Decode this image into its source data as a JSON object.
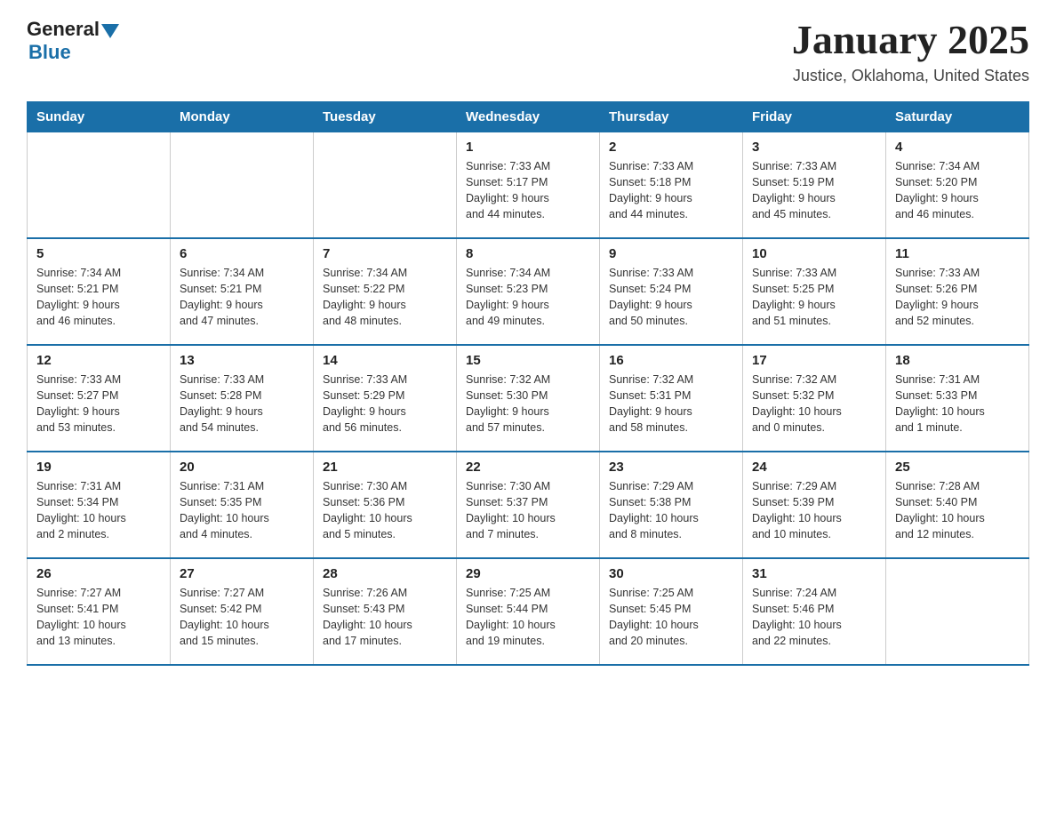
{
  "header": {
    "logo_general": "General",
    "logo_blue": "Blue",
    "title": "January 2025",
    "subtitle": "Justice, Oklahoma, United States"
  },
  "calendar": {
    "days_of_week": [
      "Sunday",
      "Monday",
      "Tuesday",
      "Wednesday",
      "Thursday",
      "Friday",
      "Saturday"
    ],
    "weeks": [
      [
        {
          "day": "",
          "info": ""
        },
        {
          "day": "",
          "info": ""
        },
        {
          "day": "",
          "info": ""
        },
        {
          "day": "1",
          "info": "Sunrise: 7:33 AM\nSunset: 5:17 PM\nDaylight: 9 hours\nand 44 minutes."
        },
        {
          "day": "2",
          "info": "Sunrise: 7:33 AM\nSunset: 5:18 PM\nDaylight: 9 hours\nand 44 minutes."
        },
        {
          "day": "3",
          "info": "Sunrise: 7:33 AM\nSunset: 5:19 PM\nDaylight: 9 hours\nand 45 minutes."
        },
        {
          "day": "4",
          "info": "Sunrise: 7:34 AM\nSunset: 5:20 PM\nDaylight: 9 hours\nand 46 minutes."
        }
      ],
      [
        {
          "day": "5",
          "info": "Sunrise: 7:34 AM\nSunset: 5:21 PM\nDaylight: 9 hours\nand 46 minutes."
        },
        {
          "day": "6",
          "info": "Sunrise: 7:34 AM\nSunset: 5:21 PM\nDaylight: 9 hours\nand 47 minutes."
        },
        {
          "day": "7",
          "info": "Sunrise: 7:34 AM\nSunset: 5:22 PM\nDaylight: 9 hours\nand 48 minutes."
        },
        {
          "day": "8",
          "info": "Sunrise: 7:34 AM\nSunset: 5:23 PM\nDaylight: 9 hours\nand 49 minutes."
        },
        {
          "day": "9",
          "info": "Sunrise: 7:33 AM\nSunset: 5:24 PM\nDaylight: 9 hours\nand 50 minutes."
        },
        {
          "day": "10",
          "info": "Sunrise: 7:33 AM\nSunset: 5:25 PM\nDaylight: 9 hours\nand 51 minutes."
        },
        {
          "day": "11",
          "info": "Sunrise: 7:33 AM\nSunset: 5:26 PM\nDaylight: 9 hours\nand 52 minutes."
        }
      ],
      [
        {
          "day": "12",
          "info": "Sunrise: 7:33 AM\nSunset: 5:27 PM\nDaylight: 9 hours\nand 53 minutes."
        },
        {
          "day": "13",
          "info": "Sunrise: 7:33 AM\nSunset: 5:28 PM\nDaylight: 9 hours\nand 54 minutes."
        },
        {
          "day": "14",
          "info": "Sunrise: 7:33 AM\nSunset: 5:29 PM\nDaylight: 9 hours\nand 56 minutes."
        },
        {
          "day": "15",
          "info": "Sunrise: 7:32 AM\nSunset: 5:30 PM\nDaylight: 9 hours\nand 57 minutes."
        },
        {
          "day": "16",
          "info": "Sunrise: 7:32 AM\nSunset: 5:31 PM\nDaylight: 9 hours\nand 58 minutes."
        },
        {
          "day": "17",
          "info": "Sunrise: 7:32 AM\nSunset: 5:32 PM\nDaylight: 10 hours\nand 0 minutes."
        },
        {
          "day": "18",
          "info": "Sunrise: 7:31 AM\nSunset: 5:33 PM\nDaylight: 10 hours\nand 1 minute."
        }
      ],
      [
        {
          "day": "19",
          "info": "Sunrise: 7:31 AM\nSunset: 5:34 PM\nDaylight: 10 hours\nand 2 minutes."
        },
        {
          "day": "20",
          "info": "Sunrise: 7:31 AM\nSunset: 5:35 PM\nDaylight: 10 hours\nand 4 minutes."
        },
        {
          "day": "21",
          "info": "Sunrise: 7:30 AM\nSunset: 5:36 PM\nDaylight: 10 hours\nand 5 minutes."
        },
        {
          "day": "22",
          "info": "Sunrise: 7:30 AM\nSunset: 5:37 PM\nDaylight: 10 hours\nand 7 minutes."
        },
        {
          "day": "23",
          "info": "Sunrise: 7:29 AM\nSunset: 5:38 PM\nDaylight: 10 hours\nand 8 minutes."
        },
        {
          "day": "24",
          "info": "Sunrise: 7:29 AM\nSunset: 5:39 PM\nDaylight: 10 hours\nand 10 minutes."
        },
        {
          "day": "25",
          "info": "Sunrise: 7:28 AM\nSunset: 5:40 PM\nDaylight: 10 hours\nand 12 minutes."
        }
      ],
      [
        {
          "day": "26",
          "info": "Sunrise: 7:27 AM\nSunset: 5:41 PM\nDaylight: 10 hours\nand 13 minutes."
        },
        {
          "day": "27",
          "info": "Sunrise: 7:27 AM\nSunset: 5:42 PM\nDaylight: 10 hours\nand 15 minutes."
        },
        {
          "day": "28",
          "info": "Sunrise: 7:26 AM\nSunset: 5:43 PM\nDaylight: 10 hours\nand 17 minutes."
        },
        {
          "day": "29",
          "info": "Sunrise: 7:25 AM\nSunset: 5:44 PM\nDaylight: 10 hours\nand 19 minutes."
        },
        {
          "day": "30",
          "info": "Sunrise: 7:25 AM\nSunset: 5:45 PM\nDaylight: 10 hours\nand 20 minutes."
        },
        {
          "day": "31",
          "info": "Sunrise: 7:24 AM\nSunset: 5:46 PM\nDaylight: 10 hours\nand 22 minutes."
        },
        {
          "day": "",
          "info": ""
        }
      ]
    ]
  }
}
